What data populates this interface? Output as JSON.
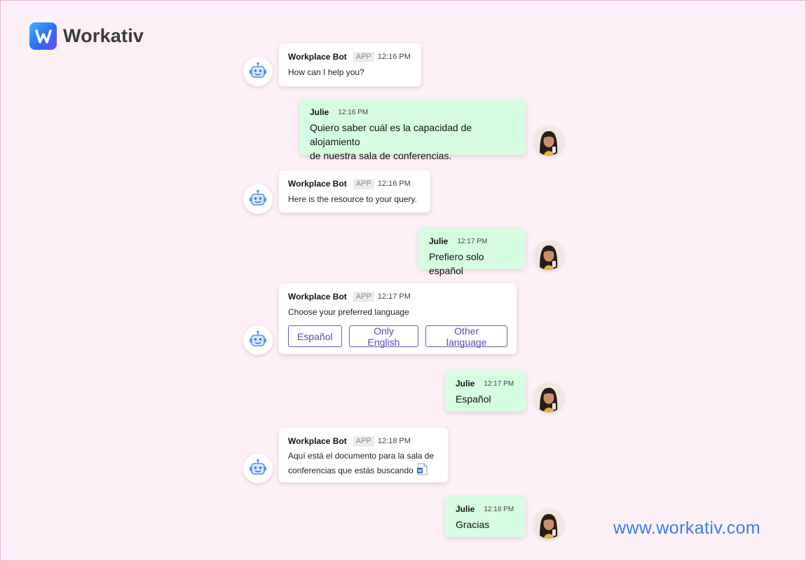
{
  "brand": {
    "name": "Workativ",
    "url": "www.workativ.com"
  },
  "bot_name": "Workplace Bot",
  "bot_badge": "APP",
  "user_name": "Julie",
  "messages": [
    {
      "time": "12:16 PM",
      "text": "How can I help you?"
    },
    {
      "time": "12:16 PM",
      "line1": "Quiero saber cuál es la capacidad de alojamiento",
      "line2": "de nuestra sala de conferencias."
    },
    {
      "time": "12:16 PM",
      "text": "Here is the resource to your query."
    },
    {
      "time": "12:17 PM",
      "text": "Prefiero solo español"
    },
    {
      "time": "12:17 PM",
      "text": "Choose your preferred language",
      "options": [
        "Español",
        "Only English",
        "Other language"
      ]
    },
    {
      "time": "12:17 PM",
      "text": "Español"
    },
    {
      "time": "12:18 PM",
      "line1": "Aquí está el documento para la sala de",
      "line2": "conferencias que estás buscando"
    },
    {
      "time": "12:18 PM",
      "text": "Gracias"
    }
  ]
}
